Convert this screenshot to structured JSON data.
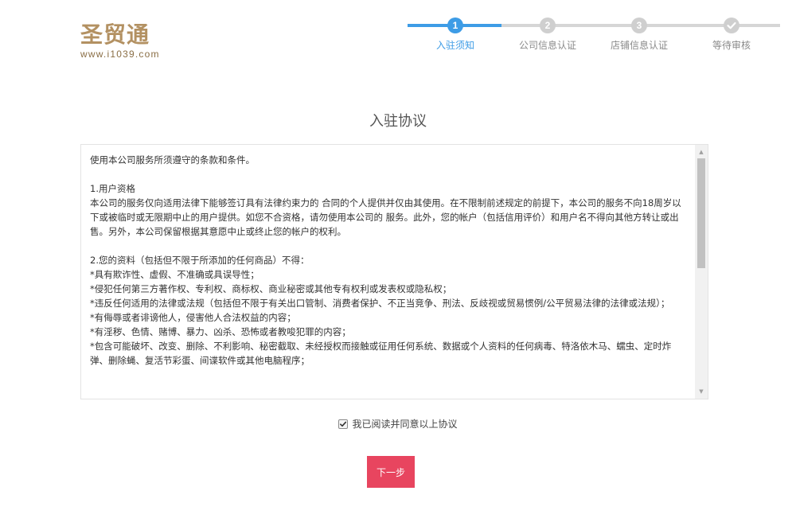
{
  "logo": {
    "name_cn": "圣贸通",
    "url": "www.i1039.com"
  },
  "steps": [
    {
      "number": "1",
      "label": "入驻须知",
      "state": "active"
    },
    {
      "number": "2",
      "label": "公司信息认证",
      "state": "pending"
    },
    {
      "number": "3",
      "label": "店铺信息认证",
      "state": "pending"
    },
    {
      "number": "",
      "icon": "check-icon",
      "label": "等待审核",
      "state": "pending"
    }
  ],
  "page_title": "入驻协议",
  "agreement": {
    "intro": "使用本公司服务所须遵守的条款和条件。",
    "section1_title": "1.用户资格",
    "section1_body": "本公司的服务仅向适用法律下能够签订具有法律约束力的 合同的个人提供并仅由其使用。在不限制前述规定的前提下，本公司的服务不向18周岁以下或被临时或无限期中止的用户提供。如您不合资格，请勿使用本公司的 服务。此外，您的帐户（包括信用评价）和用户名不得向其他方转让或出售。另外，本公司保留根据其意愿中止或终止您的帐户的权利。",
    "section2_title": "2.您的资料（包括但不限于所添加的任何商品）不得：",
    "section2_items": [
      "*具有欺诈性、虚假、不准确或具误导性；",
      "*侵犯任何第三方著作权、专利权、商标权、商业秘密或其他专有权利或发表权或隐私权；",
      "*违反任何适用的法律或法规（包括但不限于有关出口管制、消费者保护、不正当竞争、刑法、反歧视或贸易惯例/公平贸易法律的法律或法规）；",
      "*有侮辱或者诽谤他人，侵害他人合法权益的内容；",
      "*有淫秽、色情、赌博、暴力、凶杀、恐怖或者教唆犯罪的内容；",
      "*包含可能破坏、改变、删除、不利影响、秘密截取、未经授权而接触或征用任何系统、数据或个人资料的任何病毒、特洛依木马、蠕虫、定时炸弹、删除蝇、复活节彩蛋、间谍软件或其他电脑程序；"
    ]
  },
  "agree_label": "我已阅读并同意以上协议",
  "agree_checked": true,
  "next_button": "下一步",
  "colors": {
    "brand_gold": "#b39162",
    "step_active": "#3d9ce6",
    "step_inactive": "#cfcfcf",
    "button_primary": "#e8455f"
  }
}
